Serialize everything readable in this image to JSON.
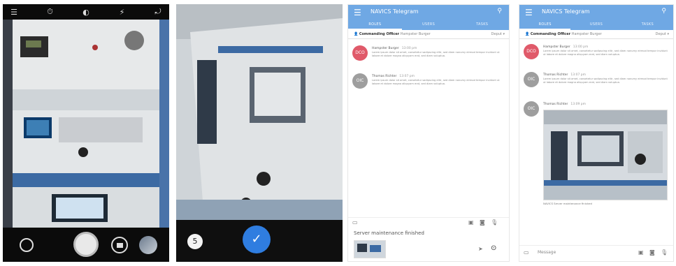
{
  "camera": {
    "top_icons": [
      "menu-icon",
      "timer-icon",
      "hdr-icon",
      "flash-icon",
      "rotate-icon"
    ]
  },
  "preview": {
    "retake_label": "5",
    "confirm_icon": "check"
  },
  "chat_a": {
    "app_title": "NAVICS Telegram",
    "tabs": [
      "ROLES",
      "USERS",
      "TASKS"
    ],
    "pinned_role": "Commanding Officer",
    "pinned_name": "Hampster Burger",
    "pinned_action": "Deput ▾",
    "messages": [
      {
        "initials": "DCO",
        "name": "Hampster Burger",
        "time": "13:00 pm",
        "color": "#e05a6a",
        "text": "Lorem ipsum dolor sit amet, consetetur sadipscing elitr, sed diam nonumy eirmod tempor invidunt ut labore et dolore magna aliquyam erat, sed diam voluptua."
      },
      {
        "initials": "OIC",
        "name": "Thomas Richter",
        "time": "13:07 pm",
        "color": "#9e9e9e",
        "text": "Lorem ipsum dolor sit amet, consetetur sadipscing elitr, sed diam nonumy eirmod tempor invidunt ut labore et dolore magna aliquyam erat, sed diam voluptua."
      }
    ],
    "composer_text": "Server maintenance finished"
  },
  "chat_b": {
    "app_title": "NAVICS Telegram",
    "tabs": [
      "ROLES",
      "USERS",
      "TASKS"
    ],
    "pinned_role": "Commanding Officer",
    "pinned_name": "Hampster Burger",
    "pinned_action": "Deput ▾",
    "messages": [
      {
        "initials": "DCO",
        "name": "Hampster Burger",
        "time": "13:00 pm",
        "color": "#e05a6a",
        "text": "Lorem ipsum dolor sit amet, consetetur sadipscing elitr, sed diam nonumy eirmod tempor invidunt ut labore et dolore magna aliquyam erat, sed diam voluptua."
      },
      {
        "initials": "OIC",
        "name": "Thomas Richter",
        "time": "13:07 pm",
        "color": "#9e9e9e",
        "text": "Lorem ipsum dolor sit amet, consetetur sadipscing elitr, sed diam nonumy eirmod tempor invidunt ut labore et dolore magna aliquyam erat, sed diam voluptua."
      },
      {
        "initials": "OIC",
        "name": "Thomas Richter",
        "time": "13:09 pm",
        "color": "#9e9e9e",
        "text": ""
      }
    ],
    "image_caption": "NAVICS Server maintenance finished",
    "composer_placeholder": "Message"
  }
}
